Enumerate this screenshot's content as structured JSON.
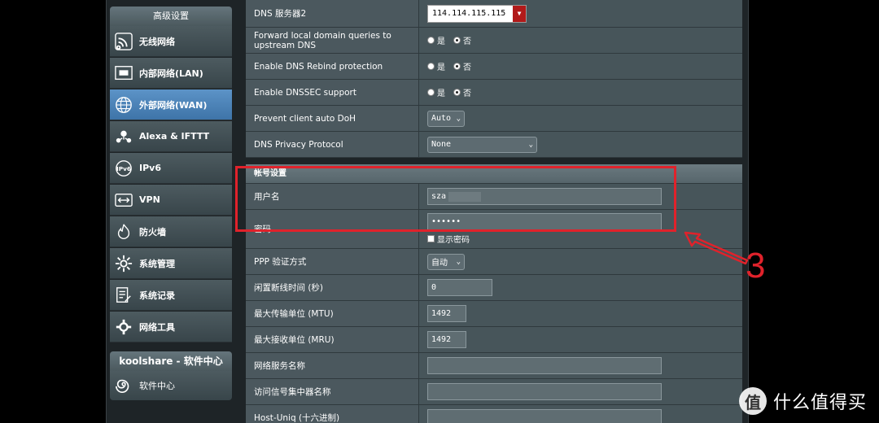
{
  "sidebar": {
    "header": "高级设置",
    "items": [
      {
        "label": "无线网络",
        "icon": "wifi-icon"
      },
      {
        "label": "内部网络(LAN)",
        "icon": "lan-icon"
      },
      {
        "label": "外部网络(WAN)",
        "icon": "globe-icon"
      },
      {
        "label": "Alexa & IFTTT",
        "icon": "alexa-icon"
      },
      {
        "label": "IPv6",
        "icon": "ipv6-icon"
      },
      {
        "label": "VPN",
        "icon": "vpn-icon"
      },
      {
        "label": "防火墙",
        "icon": "firewall-icon"
      },
      {
        "label": "系统管理",
        "icon": "gear-icon"
      },
      {
        "label": "系统记录",
        "icon": "log-icon"
      },
      {
        "label": "网络工具",
        "icon": "tools-icon"
      }
    ],
    "active_index": 2,
    "soft_header": "koolshare - 软件中心",
    "soft_item": "软件中心"
  },
  "rows": {
    "dns2": {
      "label": "DNS 服务器2",
      "value": "114.114.115.115"
    },
    "forward_local": {
      "label": "Forward local domain queries to upstream DNS",
      "yes": "是",
      "no": "否"
    },
    "rebind": {
      "label": "Enable DNS Rebind protection",
      "yes": "是",
      "no": "否"
    },
    "dnssec": {
      "label": "Enable DNSSEC support",
      "yes": "是",
      "no": "否"
    },
    "doh": {
      "label": "Prevent client auto DoH",
      "value": "Auto"
    },
    "privacy": {
      "label": "DNS Privacy Protocol",
      "value": "None"
    }
  },
  "account": {
    "section_title": "帐号设置",
    "username_label": "用户名",
    "username_value": "sza",
    "password_label": "密码",
    "password_value": "••••••",
    "show_password": "显示密码"
  },
  "more": {
    "ppp_auth": {
      "label": "PPP 验证方式",
      "value": "自动"
    },
    "idle": {
      "label": "闲置断线时间 (秒)",
      "value": "0"
    },
    "mtu": {
      "label": "最大传输单位 (MTU)",
      "value": "1492"
    },
    "mru": {
      "label": "最大接收单位 (MRU)",
      "value": "1492"
    },
    "service": {
      "label": "网络服务名称",
      "value": ""
    },
    "concentrator": {
      "label": "访问信号集中器名称",
      "value": ""
    },
    "hostuniq": {
      "label": "Host-Uniq (十六进制)",
      "value": ""
    }
  },
  "annotation": {
    "number": "3"
  },
  "watermark": {
    "logo": "值",
    "text": "什么值得买"
  }
}
